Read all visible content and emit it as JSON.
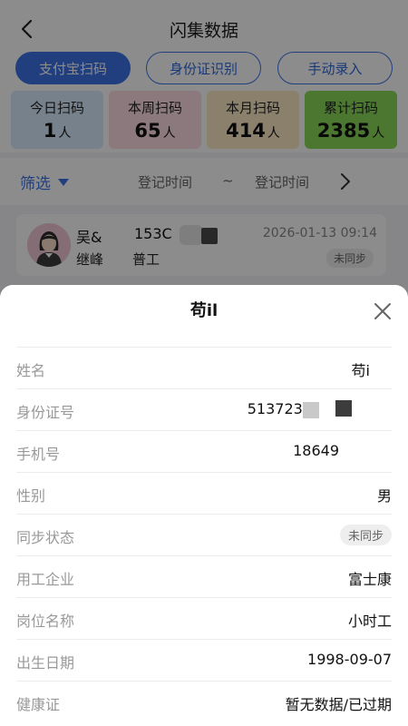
{
  "header": {
    "title": "闪集数据"
  },
  "tabs": [
    {
      "label": "支付宝扫码",
      "active": true
    },
    {
      "label": "身份证识别",
      "active": false
    },
    {
      "label": "手动录入",
      "active": false
    }
  ],
  "stats": [
    {
      "label": "今日扫码",
      "value": "1",
      "unit": "人",
      "color": "#d8ecff"
    },
    {
      "label": "本周扫码",
      "value": "65",
      "unit": "人",
      "color": "#ffdce6"
    },
    {
      "label": "本月扫码",
      "value": "414",
      "unit": "人",
      "color": "#fbe9c5"
    },
    {
      "label": "累计扫码",
      "value": "2385",
      "unit": "人",
      "color": "#8bd95a"
    }
  ],
  "filter": {
    "label": "筛选",
    "start_placeholder": "登记时间",
    "separator": "~",
    "end_placeholder": "登记时间"
  },
  "record": {
    "name": "吴&",
    "phone": "153C",
    "time": "2026-01-13 09:14",
    "company": "继峰",
    "role": "普工",
    "sync_status": "未同步"
  },
  "detail": {
    "title": "苟il",
    "fields": [
      {
        "key": "姓名",
        "value": "苟i"
      },
      {
        "key": "身份证号",
        "value": "5137237"
      },
      {
        "key": "手机号",
        "value": "18649"
      },
      {
        "key": "性别",
        "value": "男"
      },
      {
        "key": "同步状态",
        "value": "未同步",
        "pill": true
      },
      {
        "key": "用工企业",
        "value": "富士康"
      },
      {
        "key": "岗位名称",
        "value": "小时工"
      },
      {
        "key": "出生日期",
        "value": "1998-09-07"
      },
      {
        "key": "健康证",
        "value": "暂无数据/已过期"
      }
    ]
  },
  "colors": {
    "accent": "#3d74e8",
    "overlay": "rgba(0,0,0,0.45)"
  }
}
